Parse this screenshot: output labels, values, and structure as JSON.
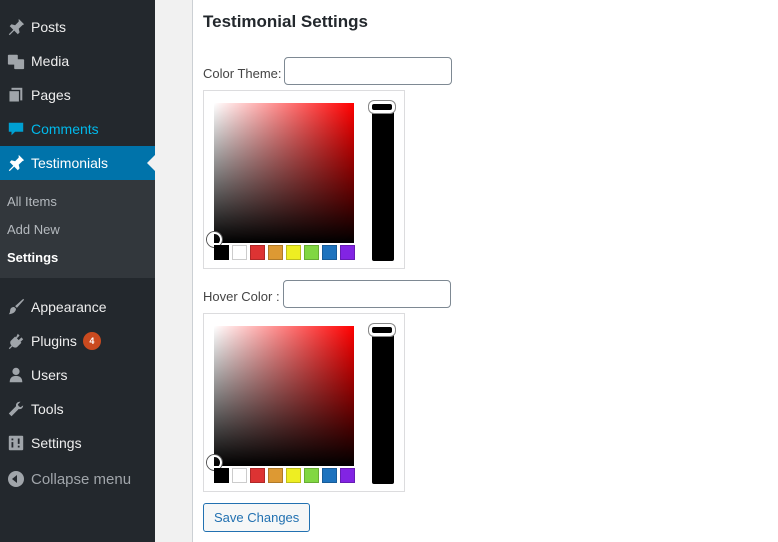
{
  "sidebar": {
    "items": [
      {
        "label": "Posts",
        "icon": "pin-icon"
      },
      {
        "label": "Media",
        "icon": "media-icon"
      },
      {
        "label": "Pages",
        "icon": "pages-icon"
      },
      {
        "label": "Comments",
        "icon": "comment-icon"
      },
      {
        "label": "Testimonials",
        "icon": "pin-icon"
      },
      {
        "label": "Appearance",
        "icon": "paintbrush-icon"
      },
      {
        "label": "Plugins",
        "icon": "plugin-icon",
        "badge": "4"
      },
      {
        "label": "Users",
        "icon": "users-icon"
      },
      {
        "label": "Tools",
        "icon": "wrench-icon"
      },
      {
        "label": "Settings",
        "icon": "settings-icon"
      }
    ],
    "submenu": [
      {
        "label": "All Items"
      },
      {
        "label": "Add New"
      },
      {
        "label": "Settings"
      }
    ],
    "collapse_label": "Collapse menu"
  },
  "main": {
    "title": "Testimonial Settings",
    "color_theme": {
      "label": "Color Theme:",
      "value": ""
    },
    "hover_color": {
      "label": "Hover Color :",
      "value": ""
    },
    "save_label": "Save Changes"
  },
  "picker": {
    "swatches": [
      "#000000",
      "#ffffff",
      "#dd3333",
      "#dd9933",
      "#eeee22",
      "#81d742",
      "#1e73be",
      "#8224e3"
    ]
  },
  "colors": {
    "sidebar_bg": "#23282d",
    "submenu_bg": "#32373c",
    "current_item": "#0073aa",
    "comments_highlight": "#00b9eb",
    "badge": "#ca4a1f"
  }
}
